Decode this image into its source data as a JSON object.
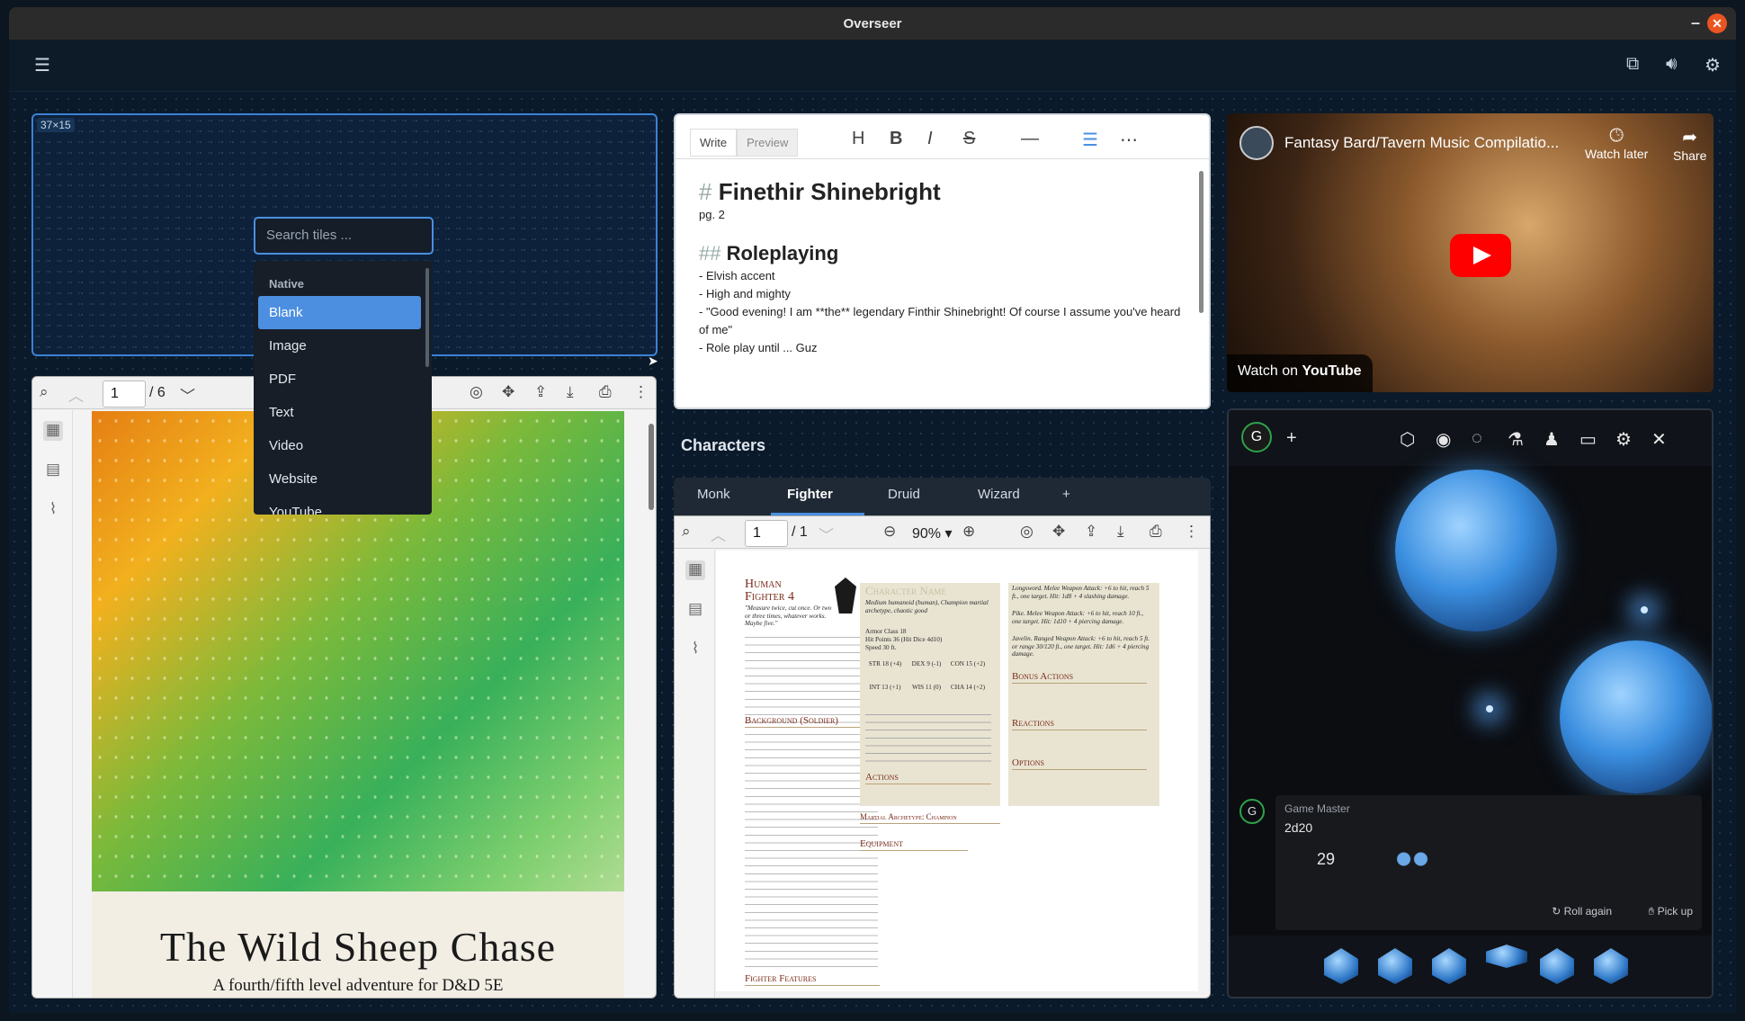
{
  "window": {
    "title": "Overseer"
  },
  "topbar": {
    "menu_icon": "hamburger-icon",
    "icons": [
      "layers-icon",
      "volume-icon",
      "gear-icon"
    ]
  },
  "blank_tile": {
    "dimensions": "37×15"
  },
  "tile_picker": {
    "placeholder": "Search tiles ...",
    "group": "Native",
    "items": [
      "Blank",
      "Image",
      "PDF",
      "Text",
      "Video",
      "Website",
      "YouTube"
    ],
    "selected": "Blank"
  },
  "pdf_left": {
    "page": "1",
    "total": "/ 6",
    "cover_title": "The Wild Sheep Chase",
    "cover_subtitle": "A fourth/fifth level adventure for D&D 5E"
  },
  "editor": {
    "tabs": [
      "Write",
      "Preview"
    ],
    "h1_mark": "#",
    "h1": "Finethir Shinebright",
    "page_ref": "pg. 2",
    "h2_mark": "##",
    "h2": "Roleplaying",
    "lines": [
      "- Elvish accent",
      "- High and mighty",
      "- \"Good evening! I am **the** legendary Finthir Shinebright! Of course I assume you've heard of me\"",
      "- Role play until ... Guz"
    ]
  },
  "youtube": {
    "title": "Fantasy Bard/Tavern Music Compilatio...",
    "watch_later": "Watch later",
    "share": "Share",
    "watch_on": "Watch on",
    "brand": "YouTube"
  },
  "characters": {
    "title": "Characters",
    "tabs": [
      "Monk",
      "Fighter",
      "Druid",
      "Wizard"
    ],
    "active_tab": "Fighter",
    "add": "+",
    "page": "1",
    "total": "/ 1",
    "zoom": "90%"
  },
  "sheet": {
    "class_title": "Human",
    "class_level": "Fighter 4",
    "quote": "\"Measure twice, cut once. Or two or three times, whatever works. Maybe five.\"",
    "bg_head": "Background (Soldier)",
    "features_head": "Fighter Features",
    "char_name": "Character Name",
    "char_desc": "Medium humanoid (human), Champion martial archetype, chaotic good",
    "armor": "Armor Class 18",
    "hp": "Hit Points 36 (Hit Dice 4d10)",
    "speed": "Speed 30 ft.",
    "stats": [
      "STR 18 (+4)",
      "DEX 9 (-1)",
      "CON 15 (+2)",
      "INT 13 (+1)",
      "WIS 11 (0)",
      "CHA 14 (+2)"
    ],
    "actions_head": "Actions",
    "bonus_head": "Bonus Actions",
    "reactions_head": "Reactions",
    "options_head": "Options",
    "archetype_head": "Martial Archetype: Champion",
    "equipment_head": "Equipment",
    "longsword": "Longsword. Melee Weapon Attack: +6 to hit, reach 5 ft., one target. Hit: 1d8 + 4 slashing damage.",
    "pike": "Pike. Melee Weapon Attack: +6 to hit, reach 10 ft., one target. Hit: 1d10 + 4 piercing damage.",
    "javelin": "Javelin. Ranged Weapon Attack: +6 to hit, reach 5 ft. or range 30/120 ft., one target. Hit: 1d6 + 4 piercing damage."
  },
  "dice": {
    "user_initial": "G",
    "roller": "Game Master",
    "expression": "2d20",
    "result": "29",
    "roll_again": "Roll again",
    "pick_up": "Pick up",
    "close": "✕"
  }
}
